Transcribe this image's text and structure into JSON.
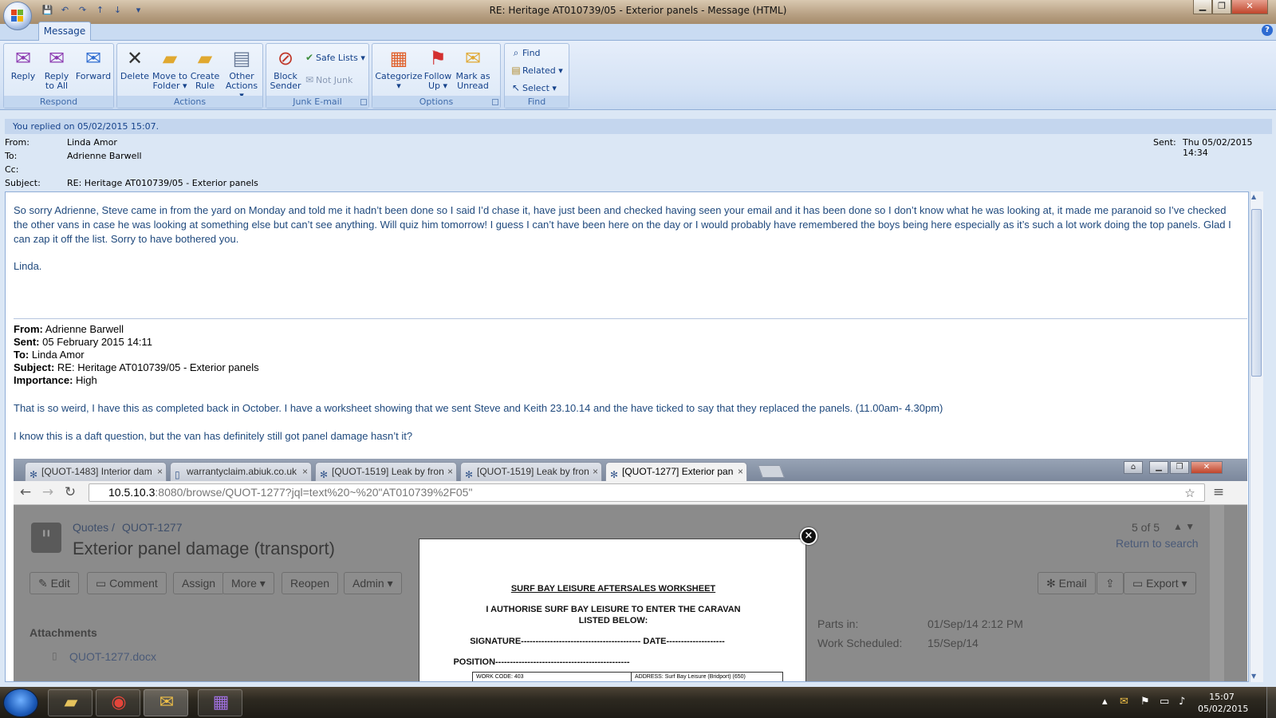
{
  "window": {
    "title": "RE: Heritage AT010739/05 - Exterior panels - Message (HTML)",
    "minimize": "▁",
    "restore": "❐",
    "close": "✕"
  },
  "qat": [
    "💾",
    "↶",
    "↷",
    "↑",
    "↓",
    "▾"
  ],
  "ribbon": {
    "tab": "Message",
    "groups": {
      "respond": {
        "label": "Respond",
        "reply": "Reply",
        "reply_all_1": "Reply",
        "reply_all_2": "to All",
        "forward": "Forward"
      },
      "actions": {
        "label": "Actions",
        "delete": "Delete",
        "move_1": "Move to",
        "move_2": "Folder ▾",
        "rule_1": "Create",
        "rule_2": "Rule",
        "other_1": "Other",
        "other_2": "Actions ▾"
      },
      "junk": {
        "label": "Junk E-mail",
        "block_1": "Block",
        "block_2": "Sender",
        "safe_lists": "Safe Lists ▾",
        "not_junk": "Not Junk"
      },
      "options": {
        "label": "Options",
        "categorize": "Categorize",
        "categorize_2": "▾",
        "follow_1": "Follow",
        "follow_2": "Up ▾",
        "mark_1": "Mark as",
        "mark_2": "Unread"
      },
      "find": {
        "label": "Find",
        "find": "Find",
        "related": "Related ▾",
        "select": "Select ▾"
      }
    }
  },
  "message": {
    "info_bar": "You replied on 05/02/2015 15:07.",
    "from_label": "From:",
    "from": "Linda Amor",
    "to_label": "To:",
    "to": "Adrienne Barwell",
    "cc_label": "Cc:",
    "cc": "",
    "subject_label": "Subject:",
    "subject": "RE: Heritage AT010739/05 - Exterior panels",
    "sent_label": "Sent:",
    "sent": "Thu 05/02/2015 14:34",
    "body_p1": "So sorry Adrienne, Steve came in from the yard on Monday and told me it hadn’t been done so I said I’d chase it, have just been and checked having seen your email and it has been done so I don’t know what he was looking at, it made me paranoid so I’ve checked the other vans in case he was looking at something else but can’t see anything.  Will quiz him tomorrow!   I guess I can’t have been here on the day or I would probably have remembered the boys being here especially as it’s such a lot work doing the top panels.  Glad I can zap it off the list.  Sorry to have bothered you.",
    "body_sign": "Linda.",
    "quoted": {
      "from_label": "From:",
      "from": "Adrienne Barwell",
      "sent_label": "Sent:",
      "sent": "05 February 2015 14:11",
      "to_label": "To:",
      "to": "Linda Amor",
      "subject_label": "Subject:",
      "subject": "RE: Heritage AT010739/05 - Exterior panels",
      "importance_label": "Importance:",
      "importance": "High",
      "p1": "That is so weird, I have this as completed back in October.  I have a worksheet showing that we sent Steve and Keith 23.10.14 and the have ticked to say that they replaced the panels.  (11.00am- 4.30pm)",
      "p2": "I know this is a daft question, but the van has definitely still got panel damage hasn’t it?"
    }
  },
  "browser": {
    "tabs": [
      "[QUOT-1483] Interior dam",
      "warrantyclaim.abiuk.co.uk",
      "[QUOT-1519] Leak by fron",
      "[QUOT-1519] Leak by fron",
      "[QUOT-1277] Exterior pan"
    ],
    "url_host": "10.5.10.3",
    "url_rest": ":8080/browse/QUOT-1277?jql=text%20~%20\"AT010739%2F05\"",
    "breadcrumb_1": "Quotes /",
    "breadcrumb_2": "QUOT-1277",
    "issue_title": "Exterior panel damage (transport)",
    "pager": "5 of 5",
    "return": "Return to search",
    "buttons": [
      "Edit",
      "Comment",
      "Assign",
      "More ▾",
      "Reopen",
      "Admin ▾"
    ],
    "right_buttons": [
      "Email",
      "",
      "Export ▾"
    ],
    "attachments_label": "Attachments",
    "attachment_file": "QUOT-1277.docx",
    "parts_in_label": "Parts in:",
    "parts_in": "01/Sep/14 2:12 PM",
    "work_sched_label": "Work Scheduled:",
    "work_sched": "15/Sep/14",
    "worksheet": {
      "title": "SURF BAY LEISURE AFTERSALES WORKSHEET",
      "auth_1": "I AUTHORISE SURF BAY LEISURE TO ENTER THE CARAVAN",
      "auth_2": "LISTED BELOW:",
      "signature": "SIGNATURE----------------------------------------- DATE--------------------",
      "position": "POSITION----------------------------------------------",
      "work_code": "WORK CODE: 403",
      "address": "ADDRESS: Surf Bay Leisure (Bridport) (650)"
    }
  },
  "taskbar": {
    "time": "15:07",
    "date": "05/02/2015"
  },
  "colors": {
    "accent": "#15428b",
    "body_text": "#1f497d",
    "ribbon": "#dce8f7"
  }
}
